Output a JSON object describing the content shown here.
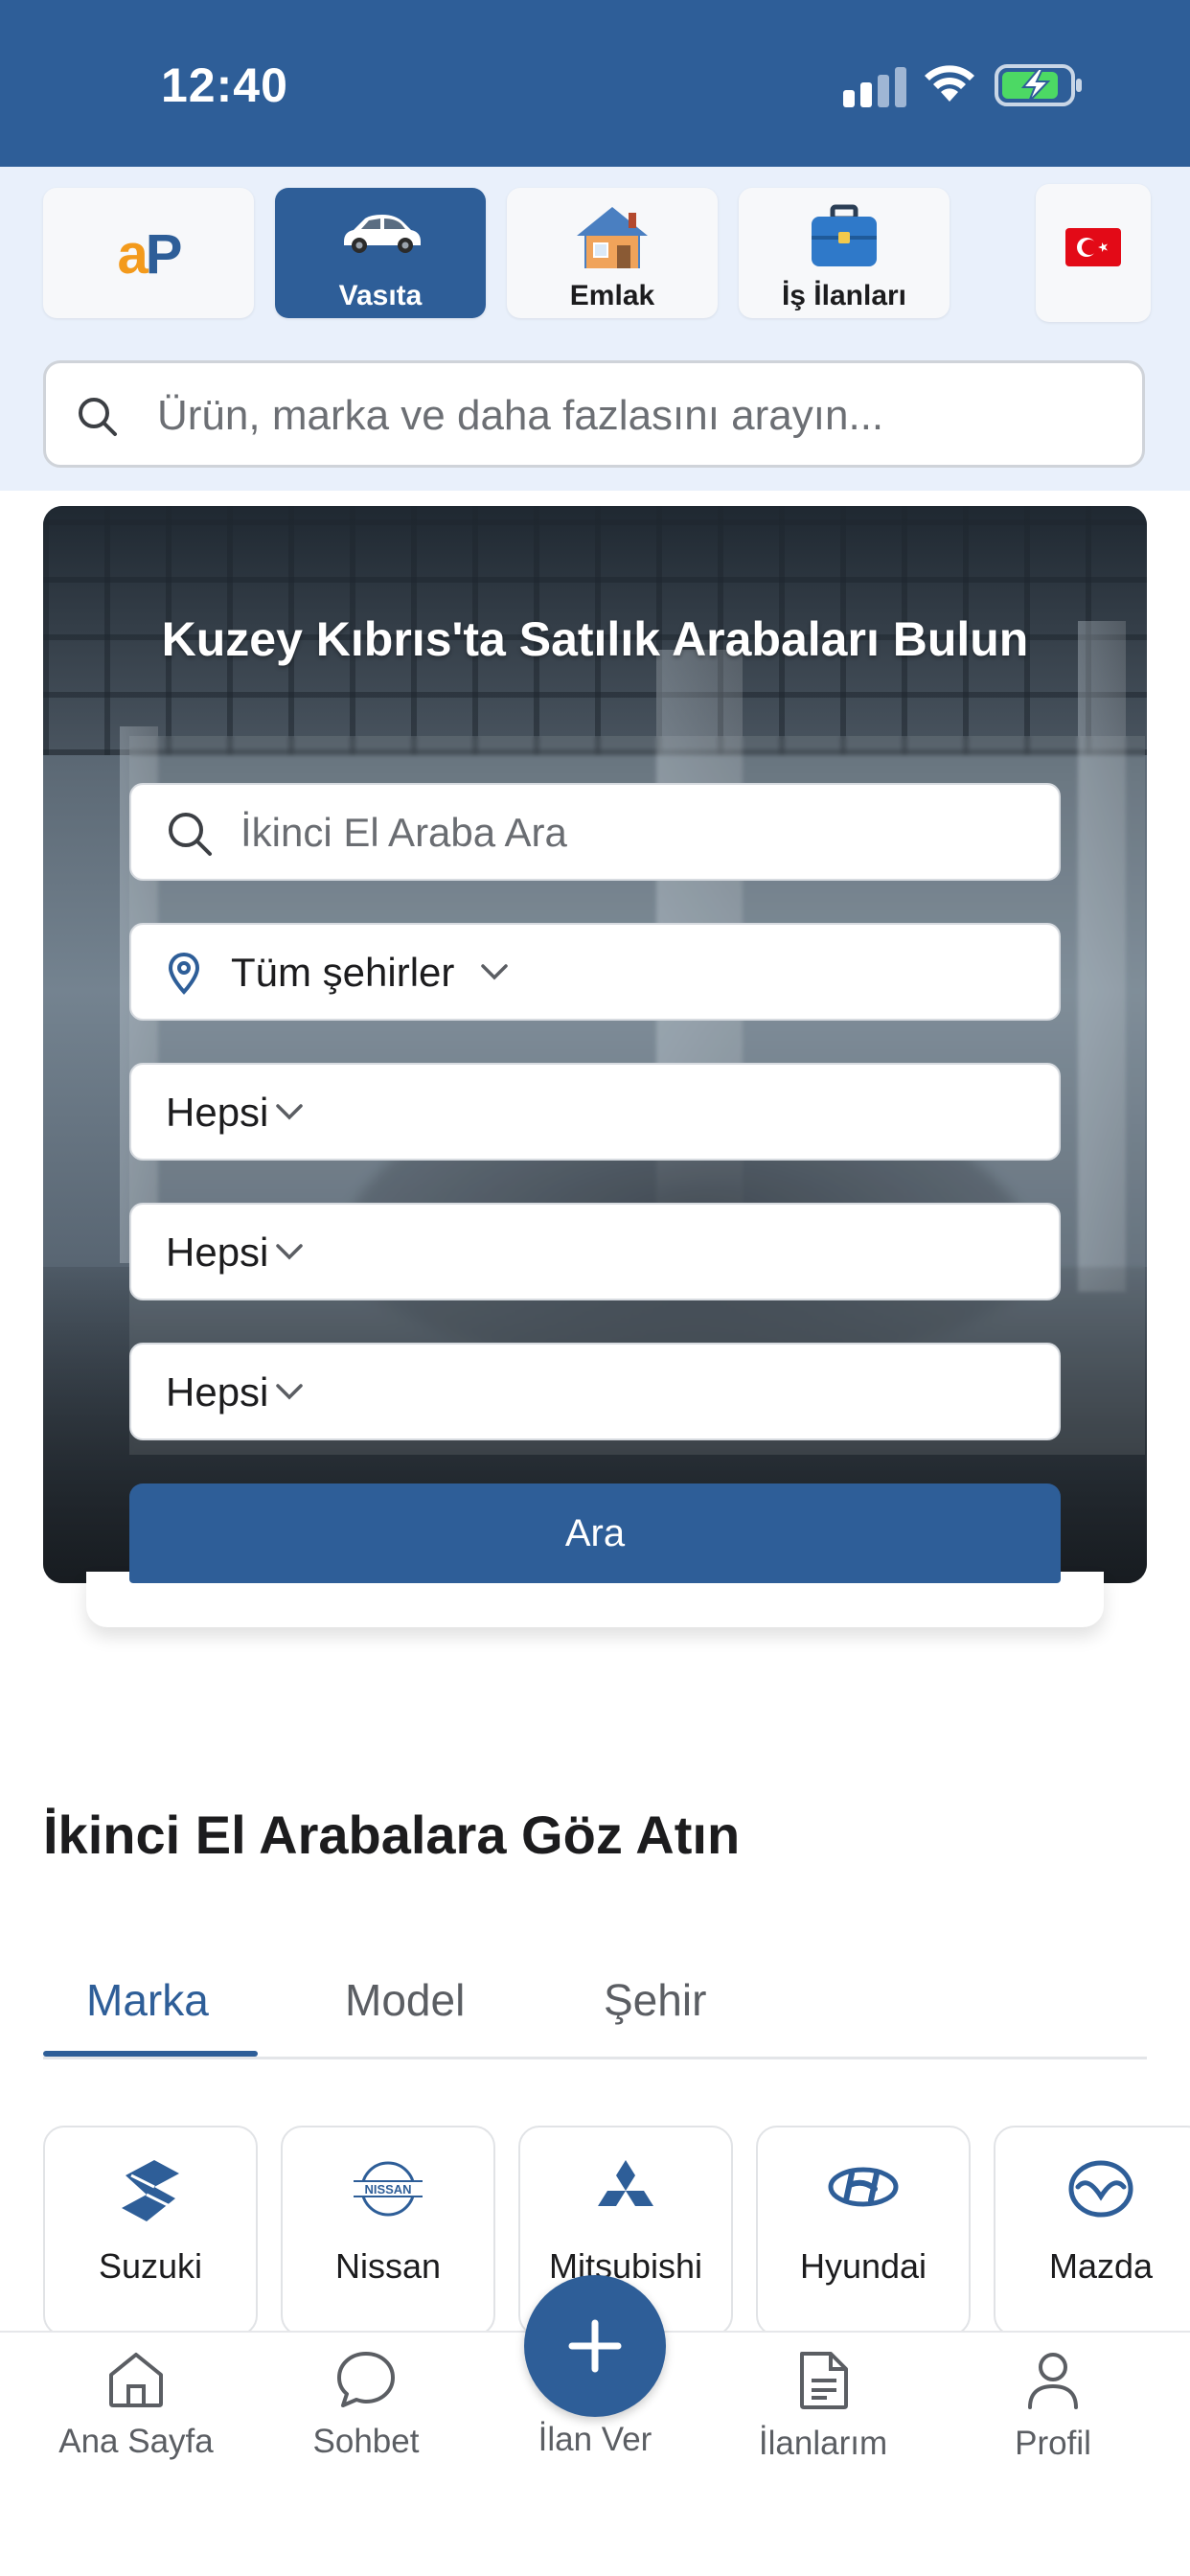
{
  "status_bar": {
    "time": "12:40"
  },
  "categories": [
    {
      "label": "",
      "logo_a": "a",
      "logo_p": "P"
    },
    {
      "label": "Vasıta",
      "active": true
    },
    {
      "label": "Emlak"
    },
    {
      "label": "İş İlanları"
    }
  ],
  "search": {
    "placeholder": "Ürün, marka ve daha fazlasını arayın..."
  },
  "hero": {
    "title": "Kuzey Kıbrıs'ta Satılık Arabaları Bulun",
    "search_placeholder": "İkinci El Araba Ara",
    "city": "Tüm şehirler",
    "filter1": "Hepsi",
    "filter2": "Hepsi",
    "filter3": "Hepsi",
    "submit": "Ara"
  },
  "section": {
    "title": "İkinci El Arabalara Göz Atın",
    "tabs": [
      "Marka",
      "Model",
      "Şehir"
    ],
    "brands": [
      "Suzuki",
      "Nissan",
      "Mitsubishi",
      "Hyundai",
      "Mazda"
    ]
  },
  "nav": {
    "home": "Ana Sayfa",
    "chat": "Sohbet",
    "post": "İlan Ver",
    "listings": "İlanlarım",
    "profile": "Profil"
  },
  "colors": {
    "brand_blue": "#2e5e98",
    "logo_orange": "#f39a1c",
    "band_bg": "#e9f0fb"
  }
}
